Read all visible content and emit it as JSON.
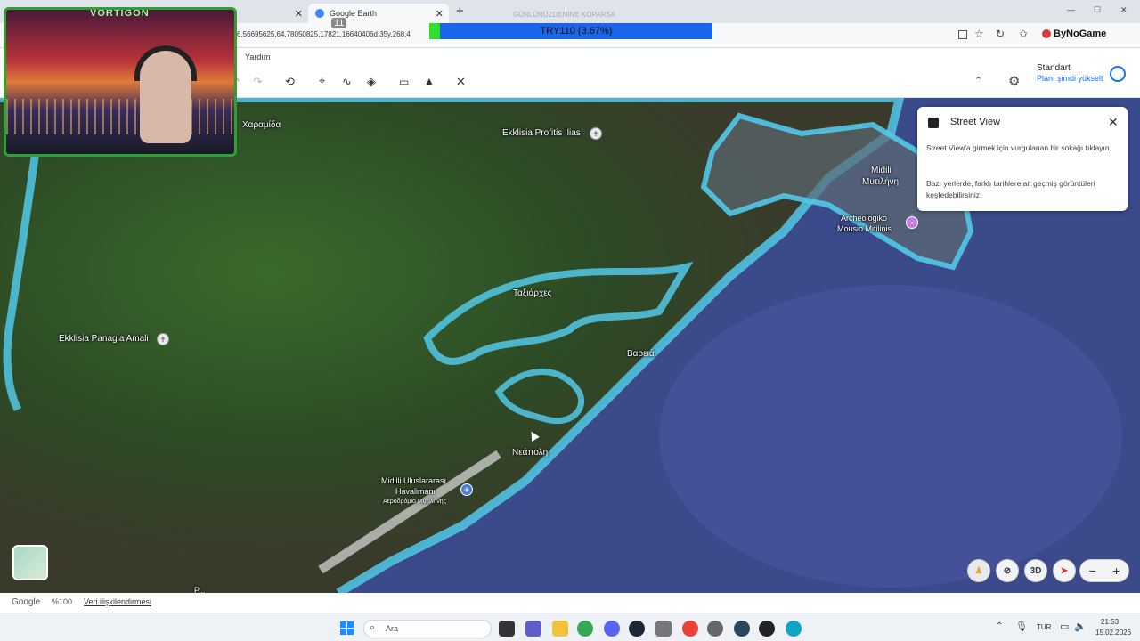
{
  "browser": {
    "tabs": [
      {
        "label": "Google Earth",
        "active": true
      }
    ],
    "new_tab_symbol": "+",
    "close_symbol": "✕",
    "url": "6,56695625,64,78050825,17821,16640406d,35y,268,4",
    "bookmark_label": "ByNoGame",
    "notification_count": "11",
    "window_controls": [
      "—",
      "☐",
      "✕"
    ]
  },
  "overlay": {
    "banner_top": "GÜNLÜNÜZDENİNE KOPARSA",
    "ticker_label": "TRY110 (3.67%)",
    "streamer_logo": "VORTIGON",
    "colors": {
      "ticker_bg": "#1a66e8",
      "ticker_green": "#2ee02e",
      "webcam_border": "#2fa12f"
    }
  },
  "ge_header": {
    "menu_help": "Yardım",
    "plan_title": "Standart",
    "plan_upgrade": "Planı şimdi yükselt"
  },
  "street_view": {
    "title": "Street View",
    "line1": "Street View'a girmek için vurgulanan bir sokağı tıklayın.",
    "line2": "Bazı yerlerde, farklı tarihlere ait geçmiş görüntüleri keşfedebilirsiniz."
  },
  "map_labels": {
    "charamida": "Χαραμίδα",
    "profitis_ilias": "Ekklisia Profitis Ilias",
    "mytilini_latin": "Midili",
    "mytilini_greek": "Μυτιλήνη",
    "museum_1": "Archeologiko",
    "museum_2": "Mousio Mitilinis",
    "taxiarches": "Ταξιάρχες",
    "panagia": "Ekklisia Panagia Amali",
    "vareia": "Βαρειά",
    "neapoli": "Νεάπολη",
    "airport_1": "Midilli Uluslararası",
    "airport_2": "Havalimanı",
    "airport_greek": "Αεροδρόμιο Μυτιλήνης",
    "partial_bottom": "Ρ..."
  },
  "map_controls": {
    "mode_3d": "3D",
    "zoom_out": "−",
    "zoom_in": "+"
  },
  "statusbar": {
    "logo": "Google",
    "zoom": "%100",
    "attribution": "Veri ilişkilendirmesi"
  },
  "taskbar": {
    "search_placeholder": "Ara",
    "language": "TUR",
    "time": "21:53",
    "date": "15.02.2026"
  }
}
